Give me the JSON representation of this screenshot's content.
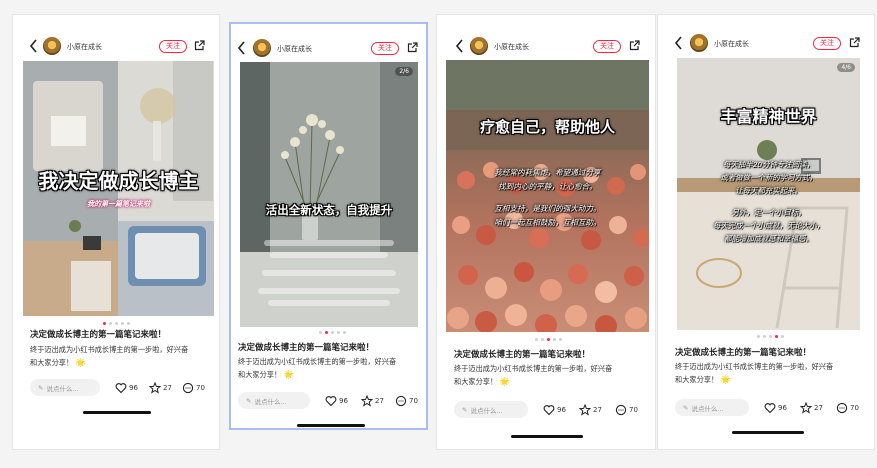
{
  "user": {
    "name": "小原在成长",
    "follow_label": "关注"
  },
  "comment_placeholder": "说点什么...",
  "stats": {
    "likes": "96",
    "stars": "27",
    "comments": "70"
  },
  "post": {
    "title": "决定做成长博主的第一篇笔记来啦！",
    "desc_line1": "终于迈出成为小红书成长博主的第一步啦，好兴奋",
    "desc_line2": "和大家分享！",
    "desc_star": "🌟"
  },
  "slides": [
    {
      "page": "",
      "headline": "我决定做成长博主",
      "subline": "我的第一篇笔记来啦"
    },
    {
      "page": "2/6",
      "headline": "活出全新状态，自我提升",
      "lines": []
    },
    {
      "page": "",
      "headline": "疗愈自己，帮助他人",
      "lines": [
        "我经常内耗焦虑，希望通过分享",
        "找到内心的平静，让心愈合。",
        "",
        "互相支持，是我们的强大动力。",
        "咱们一起互相鼓励，互相互助。"
      ]
    },
    {
      "page": "4/6",
      "headline": "丰富精神世界",
      "lines": [
        "每天抽半20分钟专注阅读，",
        "或者做做一个新的学习方式，",
        "让每天都充实起来。",
        "",
        "另外，定一个小目标，",
        "每天完成一个小成就，无论大小，",
        "都能增加成就感和幸福感。"
      ]
    }
  ],
  "colors": {
    "accent": "#ff2442",
    "selected_border": "#a9bdf0"
  }
}
